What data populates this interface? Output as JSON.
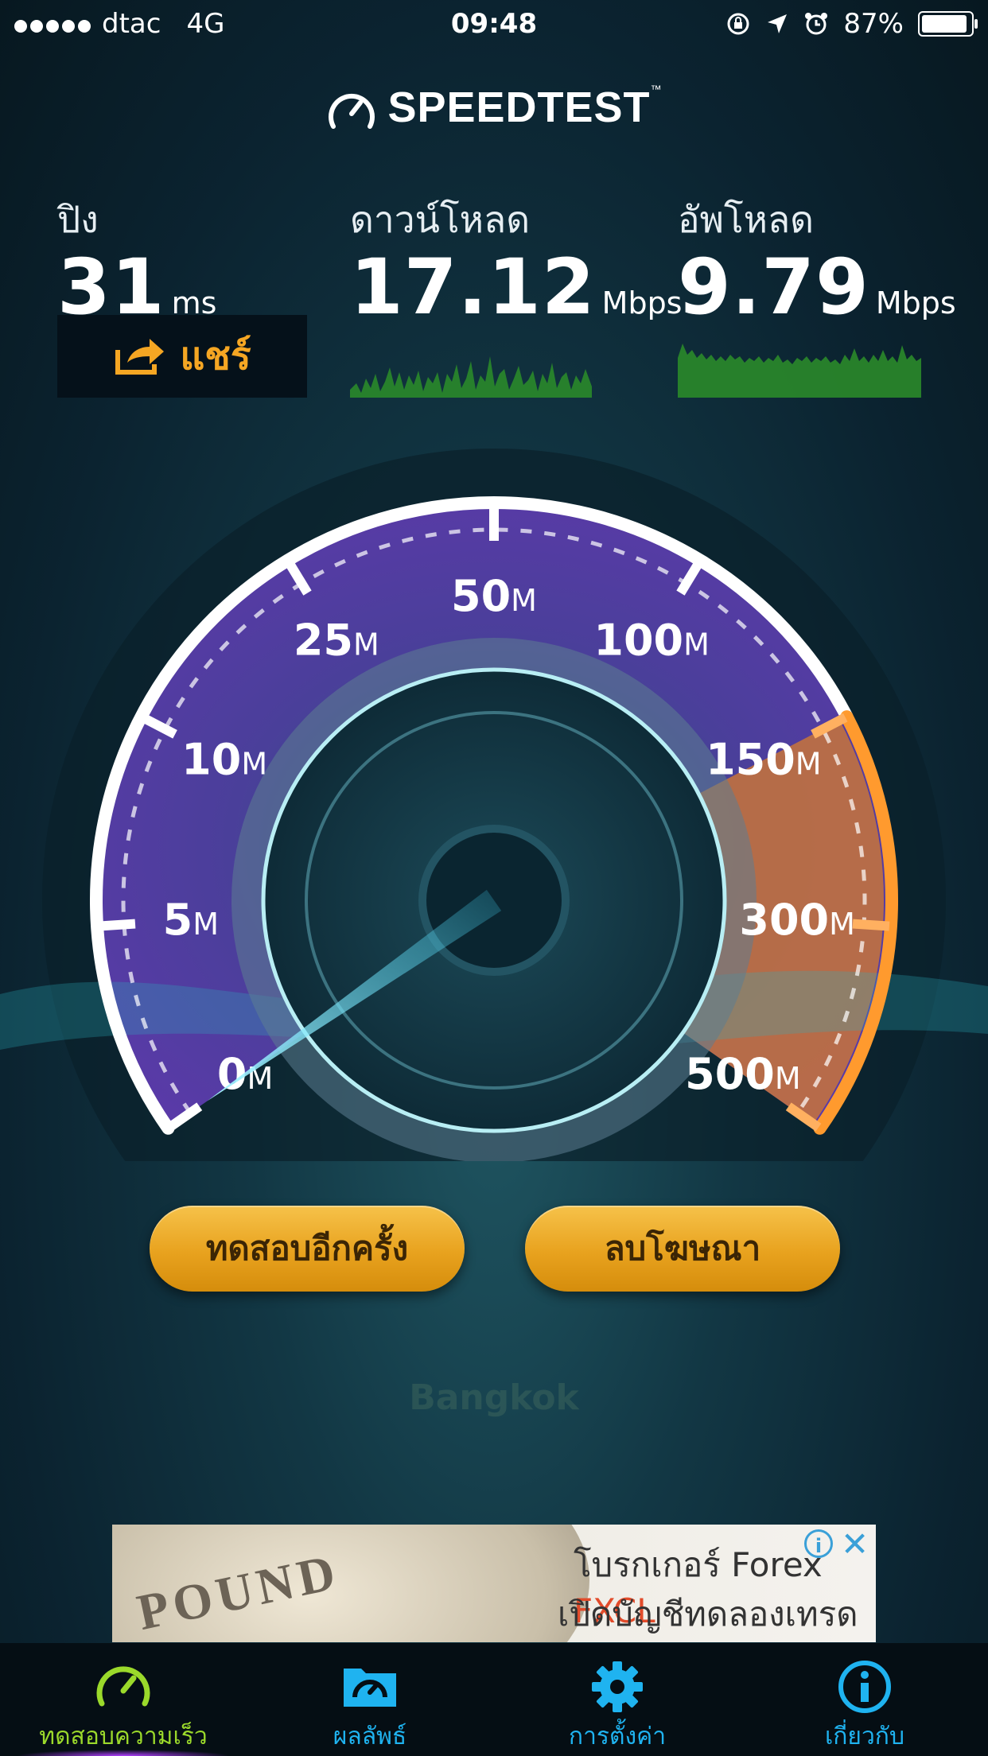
{
  "status_bar": {
    "carrier": "dtac",
    "network": "4G",
    "time": "09:48",
    "battery": "87%",
    "icons": [
      "rotation-lock-icon",
      "location-arrow-icon",
      "alarm-icon",
      "battery-icon"
    ]
  },
  "app": {
    "title": "SPEEDTEST",
    "trademark": "™"
  },
  "metrics": {
    "ping": {
      "label": "ปิง",
      "value": "31",
      "unit": "ms"
    },
    "download": {
      "label": "ดาวน์โหลด",
      "value": "17.12",
      "unit": "Mbps"
    },
    "upload": {
      "label": "อัพโหลด",
      "value": "9.79",
      "unit": "Mbps"
    }
  },
  "share_label": "แชร์",
  "gauge": {
    "scale_labels": [
      {
        "num": "0",
        "unit": "M"
      },
      {
        "num": "5",
        "unit": "M"
      },
      {
        "num": "10",
        "unit": "M"
      },
      {
        "num": "25",
        "unit": "M"
      },
      {
        "num": "50",
        "unit": "M"
      },
      {
        "num": "100",
        "unit": "M"
      },
      {
        "num": "150",
        "unit": "M"
      },
      {
        "num": "300",
        "unit": "M"
      },
      {
        "num": "500",
        "unit": "M"
      }
    ],
    "needle_value_mbps": 0
  },
  "buttons": {
    "retest": "ทดสอบอีกครั้ง",
    "remove_ads": "ลบโฆษณา"
  },
  "server_city": "Bangkok",
  "ad": {
    "coin_text": "POUND",
    "line1_prefix": "โบรกเกอร์ Forex ",
    "line1_brand": "FXCL",
    "line2": "เปิดบัญชีทดลองเทรด ฟรี!",
    "info_symbol": "i",
    "close_symbol": "✕"
  },
  "tabs": [
    {
      "label": "ทดสอบความเร็ว",
      "icon": "speedometer-icon",
      "active": true
    },
    {
      "label": "ผลลัพธ์",
      "icon": "results-folder-icon",
      "active": false
    },
    {
      "label": "การตั้งค่า",
      "icon": "settings-gear-icon",
      "active": false
    },
    {
      "label": "เกี่ยวกับ",
      "icon": "info-icon",
      "active": false
    }
  ],
  "colors": {
    "accent_orange": "#f5a623",
    "tab_active": "#9bd92b",
    "tab_inactive": "#1fb3f0"
  }
}
